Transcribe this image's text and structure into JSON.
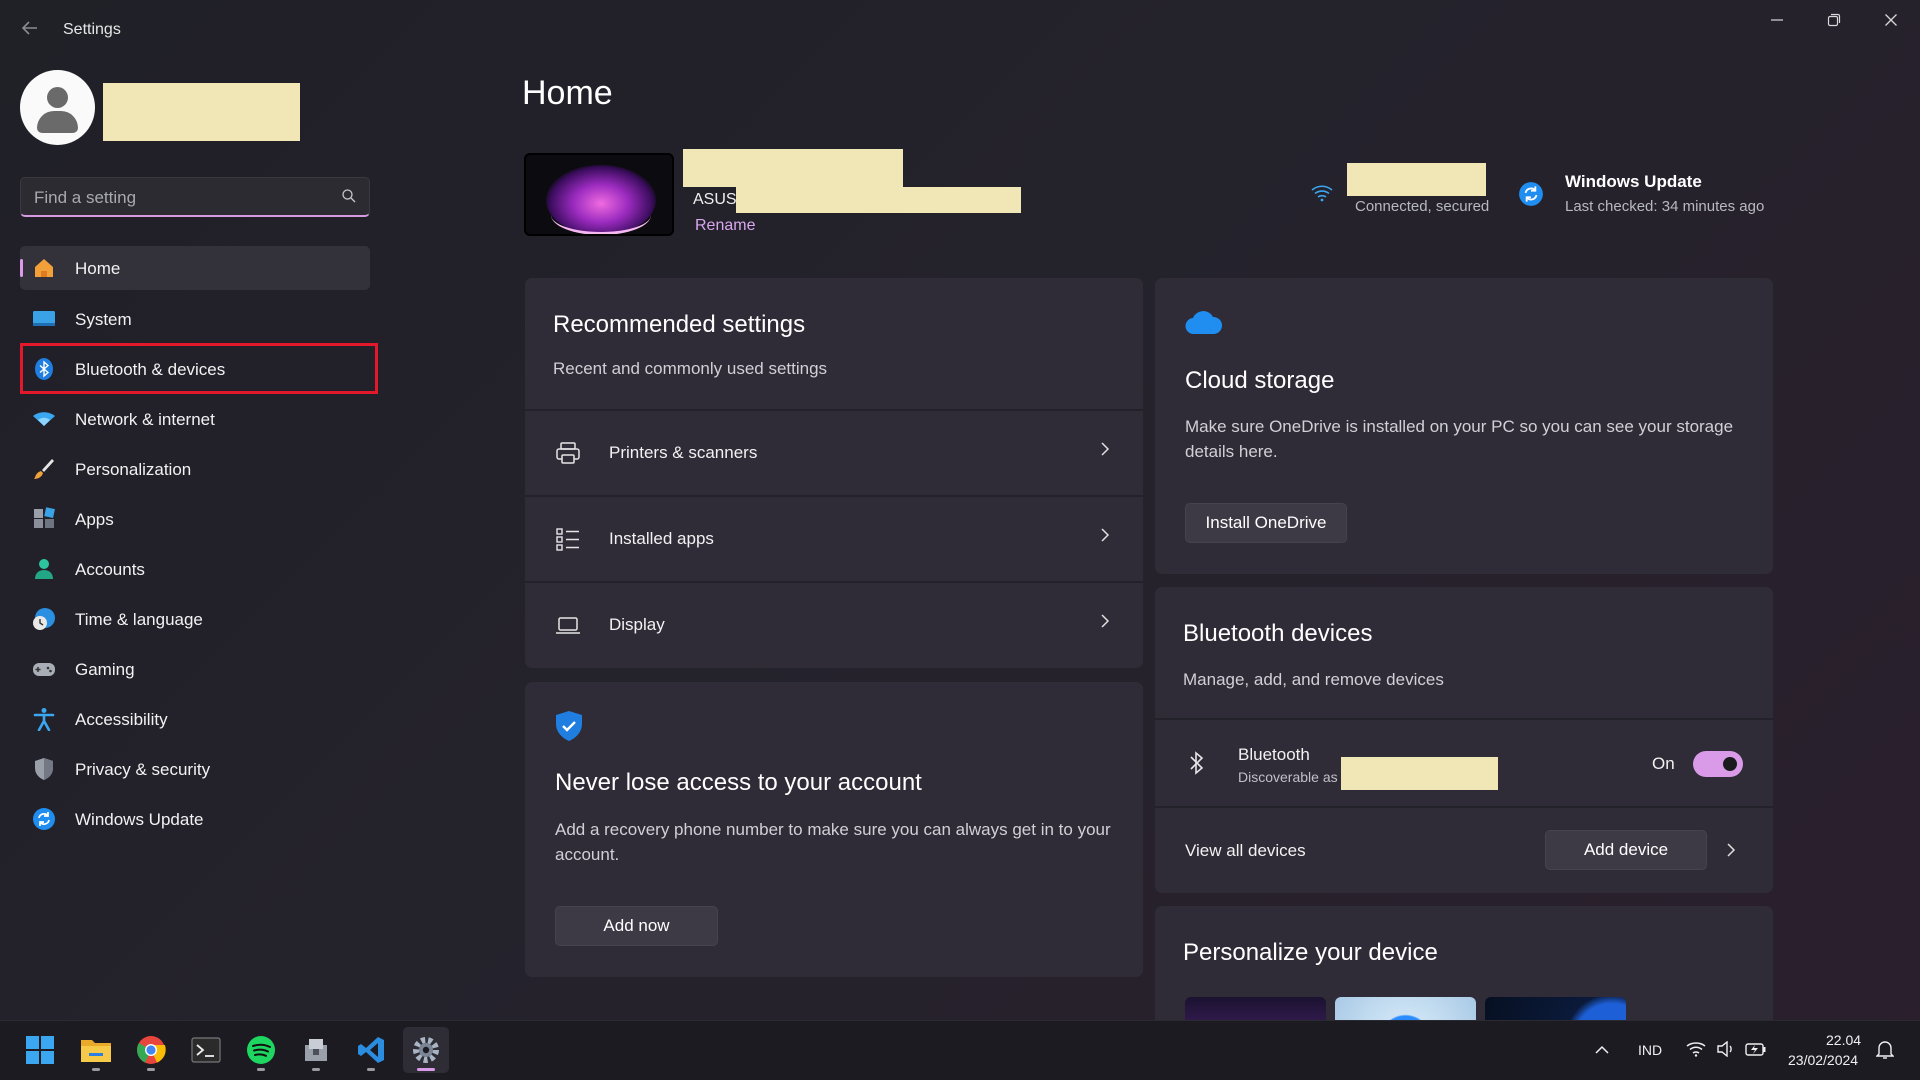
{
  "window": {
    "title": "Settings"
  },
  "sidebar": {
    "search_placeholder": "Find a setting",
    "items": [
      {
        "label": "Home",
        "icon": "home-icon",
        "active": true
      },
      {
        "label": "System",
        "icon": "system-icon"
      },
      {
        "label": "Bluetooth & devices",
        "icon": "bluetooth-icon"
      },
      {
        "label": "Network & internet",
        "icon": "wifi-icon"
      },
      {
        "label": "Personalization",
        "icon": "brush-icon"
      },
      {
        "label": "Apps",
        "icon": "apps-icon"
      },
      {
        "label": "Accounts",
        "icon": "person-icon"
      },
      {
        "label": "Time & language",
        "icon": "globe-clock-icon"
      },
      {
        "label": "Gaming",
        "icon": "gamepad-icon"
      },
      {
        "label": "Accessibility",
        "icon": "accessibility-icon"
      },
      {
        "label": "Privacy & security",
        "icon": "shield-icon"
      },
      {
        "label": "Windows Update",
        "icon": "update-icon"
      }
    ]
  },
  "header": {
    "title": "Home",
    "device_model": "ASUS",
    "rename": "Rename",
    "network_status": "Connected, secured",
    "update_title": "Windows Update",
    "update_status": "Last checked: 34 minutes ago"
  },
  "recommended": {
    "title": "Recommended settings",
    "subtitle": "Recent and commonly used settings",
    "items": [
      {
        "label": "Printers & scanners"
      },
      {
        "label": "Installed apps"
      },
      {
        "label": "Display"
      }
    ]
  },
  "account_card": {
    "title": "Never lose access to your account",
    "body": "Add a recovery phone number to make sure you can always get in to your account.",
    "button": "Add now"
  },
  "cloud_card": {
    "title": "Cloud storage",
    "body": "Make sure OneDrive is installed on your PC so you can see your storage details here.",
    "button": "Install OneDrive"
  },
  "bluetooth_card": {
    "title": "Bluetooth devices",
    "subtitle": "Manage, add, and remove devices",
    "bt_label": "Bluetooth",
    "bt_sub": "Discoverable as",
    "state": "On",
    "toggle_on": true,
    "view_all": "View all devices",
    "add_button": "Add device"
  },
  "personalize_card": {
    "title": "Personalize your device"
  },
  "taskbar": {
    "apps": [
      "start-icon",
      "file-explorer-icon",
      "chrome-icon",
      "terminal-icon",
      "spotify-icon",
      "installer-icon",
      "vscode-icon",
      "settings-icon"
    ],
    "language": "IND",
    "time": "22.04",
    "date": "23/02/2024"
  },
  "colors": {
    "accent": "#d99ae8",
    "highlight": "#e3192b",
    "background": "#202027"
  }
}
